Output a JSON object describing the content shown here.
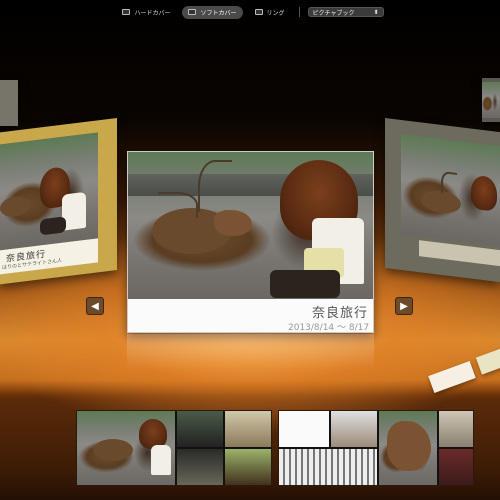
{
  "toolbar": {
    "hard_cover": "ハードカバー",
    "soft_cover": "ソフトカバー",
    "ring": "リング",
    "theme": "ピクチャブック",
    "theme_arrow": "⬍"
  },
  "center_book": {
    "title": "奈良旅行",
    "dates": "2013/8/14 ～ 8/17"
  },
  "left_book": {
    "title": "奈良旅行",
    "subtitle": "はりのとサテライトさん人"
  },
  "nav": {
    "prev": "◀",
    "next": "▶"
  },
  "colors": {
    "accent_orange": "#d9892e",
    "left_book_cover": "#c8a84a",
    "right_book_cover": "#6d6a5e"
  }
}
